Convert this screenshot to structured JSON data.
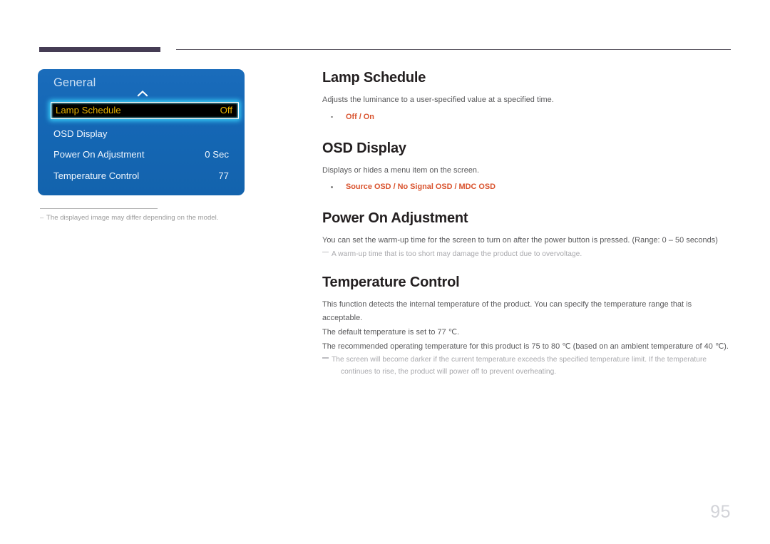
{
  "page": {
    "number": "95"
  },
  "osd": {
    "title": "General",
    "chevron_icon": "chevron-up-icon",
    "rows": [
      {
        "label": "Lamp Schedule",
        "value": "Off",
        "selected": true
      },
      {
        "label": "OSD Display",
        "value": "",
        "selected": false
      },
      {
        "label": "Power On Adjustment",
        "value": "0 Sec",
        "selected": false
      },
      {
        "label": "Temperature Control",
        "value": "77",
        "selected": false
      }
    ],
    "note": "The displayed image may differ depending on the model."
  },
  "sections": [
    {
      "title": "Lamp Schedule",
      "desc": "Adjusts the luminance to a user-specified value at a specified time.",
      "options": "Off / On"
    },
    {
      "title": "OSD Display",
      "desc": "Displays or hides a menu item on the screen.",
      "options": "Source OSD / No Signal OSD / MDC OSD"
    },
    {
      "title": "Power On Adjustment",
      "desc": "You can set the warm-up time for the screen to turn on after the power button is pressed. (Range: 0 – 50 seconds)",
      "note": "A warm-up time that is too short may damage the product due to overvoltage."
    },
    {
      "title": "Temperature Control",
      "desc1": "This function detects the internal temperature of the product. You can specify the temperature range that is acceptable.",
      "desc2": "The default temperature is set to 77 ℃.",
      "desc3": "The recommended operating temperature for this product is 75 to 80 ℃ (based on an ambient temperature of 40 ℃).",
      "note_line1": "The screen will become darker if the current temperature exceeds the specified temperature limit. If the temperature",
      "note_line2": "continues to rise, the product will power off to prevent overheating."
    }
  ],
  "colors": {
    "accent_orange": "#d9532e",
    "osd_blue": "#1567b5",
    "osd_highlight_text": "#e8b200",
    "header_bar": "#453c54"
  }
}
